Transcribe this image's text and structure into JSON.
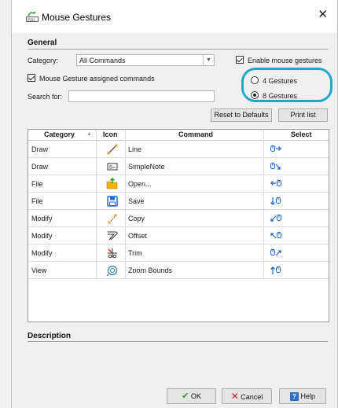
{
  "window": {
    "title": "Mouse Gestures",
    "close_glyph": "✕"
  },
  "general": {
    "header": "General",
    "category_label": "Category:",
    "category_value": "All Commands",
    "enable_label": "Enable mouse gestures",
    "assigned_label": "Mouse Gesture assigned commands",
    "search_label": "Search for:",
    "search_value": "",
    "gestures_4_label": "4 Gestures",
    "gestures_8_label": "8 Gestures",
    "gestures_selected": "8 Gestures",
    "reset_label": "Reset to Defaults",
    "print_label": "Print list",
    "highlight_color": "#20a7c7"
  },
  "table": {
    "headers": {
      "category": "Category",
      "icon": "Icon",
      "command": "Command",
      "select": "Select"
    },
    "rows": [
      {
        "category": "Draw",
        "icon": "line-icon",
        "command": "Line",
        "gesture": "right-gesture-icon"
      },
      {
        "category": "Draw",
        "icon": "simplenote-icon",
        "command": "SimpleNote",
        "gesture": "down-right-gesture-icon"
      },
      {
        "category": "File",
        "icon": "open-folder-icon",
        "command": "Open...",
        "gesture": "left-gesture-icon"
      },
      {
        "category": "File",
        "icon": "save-icon",
        "command": "Save",
        "gesture": "down-gesture-icon"
      },
      {
        "category": "Modify",
        "icon": "copy-icon",
        "command": "Copy",
        "gesture": "down-left-gesture-icon"
      },
      {
        "category": "Modify",
        "icon": "offset-icon",
        "command": "Offset",
        "gesture": "up-left-gesture-icon"
      },
      {
        "category": "Modify",
        "icon": "trim-icon",
        "command": "Trim",
        "gesture": "up-right-gesture-icon"
      },
      {
        "category": "View",
        "icon": "zoom-bounds-icon",
        "command": "Zoom Bounds",
        "gesture": "up-gesture-icon"
      }
    ]
  },
  "description": {
    "header": "Description"
  },
  "footer": {
    "ok_label": "OK",
    "cancel_label": "Cancel",
    "help_label": "Help"
  }
}
